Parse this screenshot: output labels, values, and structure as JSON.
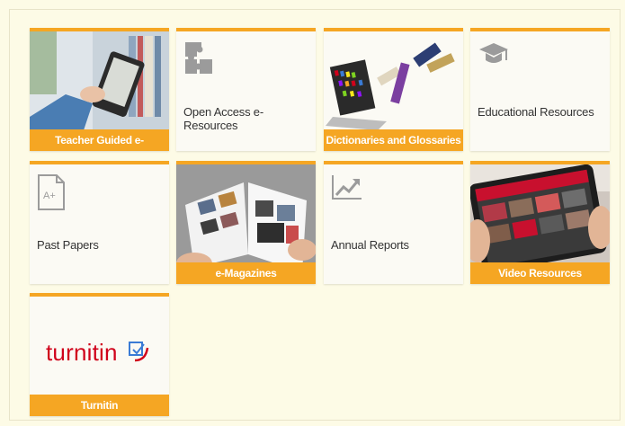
{
  "tiles": {
    "t1": {
      "label": "Teacher Guided e-Resources",
      "icon": "ebook-reader-photo"
    },
    "t2": {
      "label": "Open Access e-Resources",
      "icon": "puzzle-icon"
    },
    "t3": {
      "label": "Dictionaries and Glossaries",
      "icon": "books-laptop-photo"
    },
    "t4": {
      "label": "Educational Resources",
      "icon": "graduation-cap-icon"
    },
    "t5": {
      "label": "Past Papers",
      "icon": "document-grade-icon",
      "badge": "A+"
    },
    "t6": {
      "label": "e-Magazines",
      "icon": "magazine-photo"
    },
    "t7": {
      "label": "Annual Reports",
      "icon": "trend-chart-icon"
    },
    "t8": {
      "label": "Video Resources",
      "icon": "tablet-video-photo"
    },
    "t9": {
      "label": "Turnitin",
      "logo": "turnitin",
      "icon": "turnitin-logo"
    }
  },
  "colors": {
    "accent": "#f5a623",
    "background": "#fdfbe6",
    "brand_red": "#d0021b"
  }
}
